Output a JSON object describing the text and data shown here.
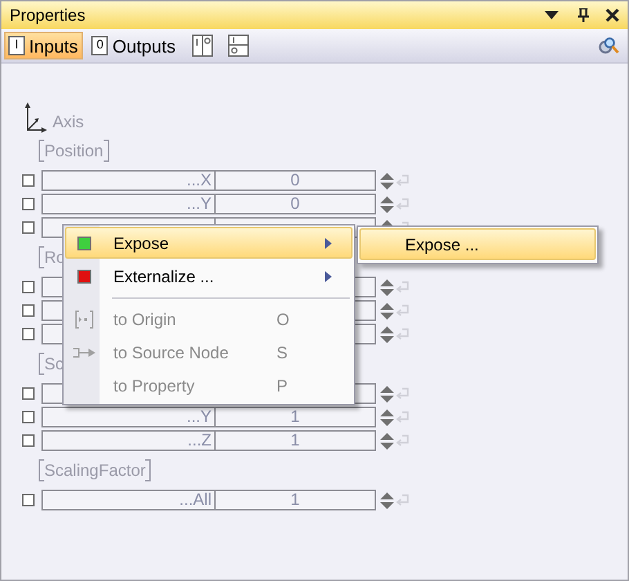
{
  "window": {
    "title": "Properties"
  },
  "toolbar": {
    "tabs": [
      {
        "label": "Inputs",
        "glyph": "I",
        "selected": true
      },
      {
        "label": "Outputs",
        "glyph": "0",
        "selected": false
      }
    ]
  },
  "node": {
    "label": "Axis"
  },
  "groups": [
    {
      "label": "Position",
      "rows": [
        {
          "name": "...X",
          "value": "0",
          "checked": false
        },
        {
          "name": "...Y",
          "value": "0",
          "checked": false
        },
        {
          "checked": false
        }
      ]
    },
    {
      "label": "Ro",
      "rows": [
        {
          "checked": false
        },
        {
          "checked": false
        },
        {
          "checked": false
        }
      ]
    },
    {
      "label": "Sc",
      "rows": [
        {
          "checked": false
        },
        {
          "name": "...Y",
          "value": "1",
          "checked": false
        },
        {
          "name": "...Z",
          "value": "1",
          "checked": false
        }
      ]
    },
    {
      "label": "ScalingFactor",
      "rows": [
        {
          "name": "...All",
          "value": "1",
          "checked": false
        }
      ]
    }
  ],
  "context_menu": {
    "items": [
      {
        "kind": "item",
        "label": "Expose",
        "color": "#3fcf3f",
        "submenu": true,
        "selected": true,
        "disabled": false
      },
      {
        "kind": "item",
        "label": "Externalize ...",
        "color": "#e01010",
        "submenu": true,
        "selected": false,
        "disabled": false
      },
      {
        "kind": "separator"
      },
      {
        "kind": "item",
        "label": "to Origin",
        "shortcut": "O",
        "selected": false,
        "disabled": true
      },
      {
        "kind": "item",
        "label": "to Source Node",
        "shortcut": "S",
        "selected": false,
        "disabled": true
      },
      {
        "kind": "item",
        "label": "to Property",
        "shortcut": "P",
        "selected": false,
        "disabled": true
      }
    ]
  },
  "submenu": {
    "items": [
      {
        "label": "Expose ...",
        "selected": true
      }
    ]
  }
}
